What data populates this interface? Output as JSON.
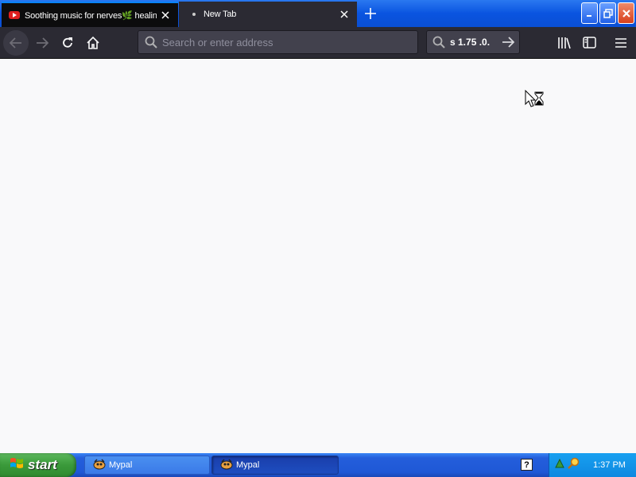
{
  "browser": {
    "tabs": [
      {
        "title": "Soothing music for nerves🌿 healing",
        "icon": "youtube-icon",
        "active": true
      },
      {
        "title": "New Tab",
        "icon": "dot-icon",
        "active": false
      }
    ],
    "urlbar": {
      "placeholder": "Search or enter address",
      "value": ""
    },
    "searchbar": {
      "value": "s 1.75 .0."
    }
  },
  "taskbar": {
    "start_label": "start",
    "tasks": [
      {
        "label": "Mypal",
        "active": false
      },
      {
        "label": "Mypal",
        "active": true
      }
    ],
    "clock": "1:37 PM"
  },
  "colors": {
    "titlebar": "#0a54e0",
    "toolbar": "#2b2a33",
    "content": "#f9f9fa",
    "taskbar": "#245edb",
    "start": "#3a9a3a",
    "tray": "#0e88e0"
  }
}
